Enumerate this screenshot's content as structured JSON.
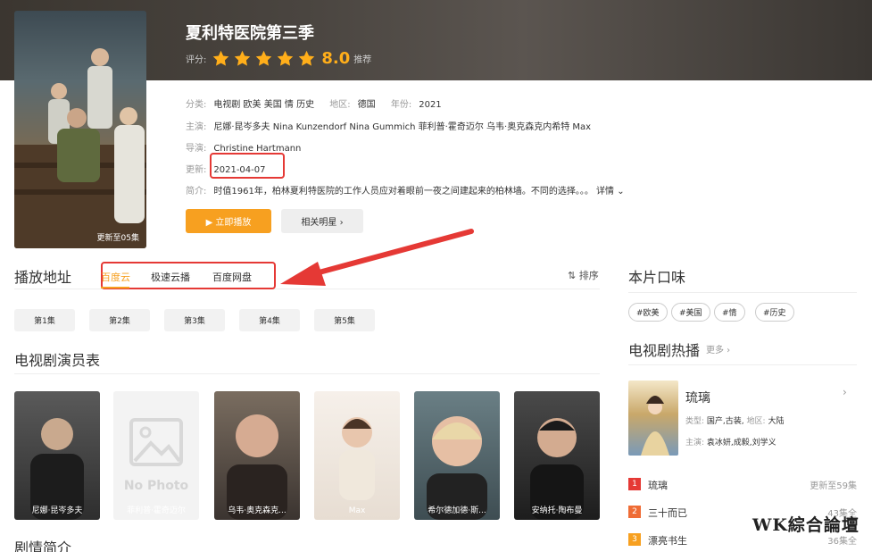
{
  "header": {
    "title": "夏利特医院第三季",
    "rating_label": "评分:",
    "score": "8.0",
    "score_tag": "推荐",
    "stars": 5,
    "poster_badge": "更新至05集"
  },
  "meta": {
    "category_label": "分类:",
    "category": "电视剧 欧美 美国 情 历史",
    "region_label": "地区:",
    "region": "德国",
    "year_label": "年份:",
    "year": "2021",
    "cast_label": "主演:",
    "cast": "尼娜·昆岑多夫 Nina Kunzendorf Nina Gummich 菲利普·霍奇迈尔 乌韦·奥克森克内希特 Max",
    "director_label": "导演:",
    "director": "Christine Hartmann",
    "update_label": "更新:",
    "update": "2021-04-07",
    "intro_label": "简介:",
    "intro": "时值1961年，柏林夏利特医院的工作人员应对着眼前一夜之间建起来的柏林墙。不同的选择。。。",
    "detail": "详情 ⌄"
  },
  "buttons": {
    "play": "▶ 立即播放",
    "stars": "相关明星 ›"
  },
  "playback": {
    "heading": "播放地址",
    "sources": [
      "百度云",
      "极速云播",
      "百度网盘"
    ],
    "sort": "排序",
    "episodes": [
      "第1集",
      "第2集",
      "第3集",
      "第4集",
      "第5集"
    ]
  },
  "cast_section": {
    "heading": "电视剧演员表",
    "members": [
      {
        "name": "尼娜·昆岑多夫"
      },
      {
        "name": "菲利普·霍奇迈尔",
        "placeholder": "No Photo"
      },
      {
        "name": "乌韦·奥克森克..."
      },
      {
        "name": "Max"
      },
      {
        "name": "希尔德加德·斯..."
      },
      {
        "name": "安纳托·陶布曼"
      }
    ]
  },
  "synopsis_heading": "剧情简介",
  "taste": {
    "heading": "本片口味",
    "tags": [
      "#欧美",
      "#美国",
      "#情",
      "#历史"
    ]
  },
  "hot": {
    "heading": "电视剧热播",
    "more": "更多 ›",
    "featured": {
      "title": "琉璃",
      "type_label": "类型:",
      "type": "国产,古装,",
      "region_label": "地区:",
      "region": "大陆",
      "cast_label": "主演:",
      "cast": "袁冰妍,成毅,刘学义"
    },
    "ranks": [
      {
        "num": "1",
        "name": "琉璃",
        "update": "更新至59集",
        "color": "#e53935"
      },
      {
        "num": "2",
        "name": "三十而已",
        "update": "43集全",
        "color": "#ef6c35"
      },
      {
        "num": "3",
        "name": "漂亮书生",
        "update": "36集全",
        "color": "#f7a020"
      }
    ]
  },
  "watermark": "WK綜合論壇",
  "colors": {
    "accent": "#f7a020",
    "highlight": "#e53935"
  }
}
